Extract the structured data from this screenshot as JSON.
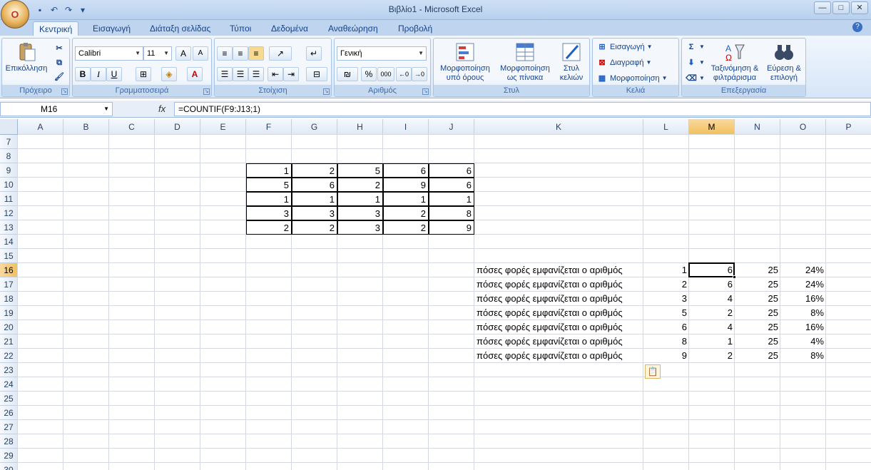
{
  "title": "Βιβλίο1 - Microsoft Excel",
  "office_button_label": "O",
  "window_buttons": [
    "—",
    "□",
    "✕"
  ],
  "tabs": [
    "Κεντρική",
    "Εισαγωγή",
    "Διάταξη σελίδας",
    "Τύποι",
    "Δεδομένα",
    "Αναθεώρηση",
    "Προβολή"
  ],
  "active_tab": 0,
  "ribbon": {
    "clipboard": {
      "label": "Πρόχειρο",
      "paste": "Επικόλληση"
    },
    "font": {
      "label": "Γραμματοσειρά",
      "name": "Calibri",
      "size": "11",
      "bold": "B",
      "italic": "I",
      "underline": "U"
    },
    "alignment": {
      "label": "Στοίχιση"
    },
    "number": {
      "label": "Αριθμός",
      "format": "Γενική",
      "percent": "%",
      "thousands": "000"
    },
    "styles": {
      "label": "Στυλ",
      "cond1": "Μορφοποίηση",
      "cond2": "υπό όρους",
      "table1": "Μορφοποίηση",
      "table2": "ως πίνακα",
      "cell1": "Στυλ",
      "cell2": "κελιών"
    },
    "cells": {
      "label": "Κελιά",
      "insert": "Εισαγωγή",
      "delete": "Διαγραφή",
      "format": "Μορφοποίηση"
    },
    "editing": {
      "label": "Επεξεργασία",
      "sort1": "Ταξινόμηση &",
      "sort2": "φιλτράρισμα",
      "find1": "Εύρεση &",
      "find2": "επιλογή"
    }
  },
  "name_box": "M16",
  "fx": "fx",
  "formula": "=COUNTIF(F9:J13;1)",
  "columns": [
    "A",
    "B",
    "C",
    "D",
    "E",
    "F",
    "G",
    "H",
    "I",
    "J",
    "K",
    "L",
    "M",
    "N",
    "O",
    "P"
  ],
  "rows": [
    7,
    8,
    9,
    10,
    11,
    12,
    13,
    14,
    15,
    16,
    17,
    18,
    19,
    20,
    21,
    22,
    23,
    24,
    25,
    26,
    27,
    28,
    29,
    30
  ],
  "matrix": [
    [
      1,
      2,
      5,
      6,
      6
    ],
    [
      5,
      6,
      2,
      9,
      6
    ],
    [
      1,
      1,
      1,
      1,
      1
    ],
    [
      3,
      3,
      3,
      2,
      8
    ],
    [
      2,
      2,
      3,
      2,
      9
    ]
  ],
  "summary": [
    {
      "label": "πόσες φορές εμφανίζεται ο αριθμός",
      "n": 1,
      "count": 6,
      "total": 25,
      "pct": "24%"
    },
    {
      "label": "πόσες φορές εμφανίζεται ο αριθμός",
      "n": 2,
      "count": 6,
      "total": 25,
      "pct": "24%"
    },
    {
      "label": "πόσες φορές εμφανίζεται ο αριθμός",
      "n": 3,
      "count": 4,
      "total": 25,
      "pct": "16%"
    },
    {
      "label": "πόσες φορές εμφανίζεται ο αριθμός",
      "n": 5,
      "count": 2,
      "total": 25,
      "pct": "8%"
    },
    {
      "label": "πόσες φορές εμφανίζεται ο αριθμός",
      "n": 6,
      "count": 4,
      "total": 25,
      "pct": "16%"
    },
    {
      "label": "πόσες φορές εμφανίζεται ο αριθμός",
      "n": 8,
      "count": 1,
      "total": 25,
      "pct": "4%"
    },
    {
      "label": "πόσες φορές εμφανίζεται ο αριθμός",
      "n": 9,
      "count": 2,
      "total": 25,
      "pct": "8%"
    }
  ]
}
